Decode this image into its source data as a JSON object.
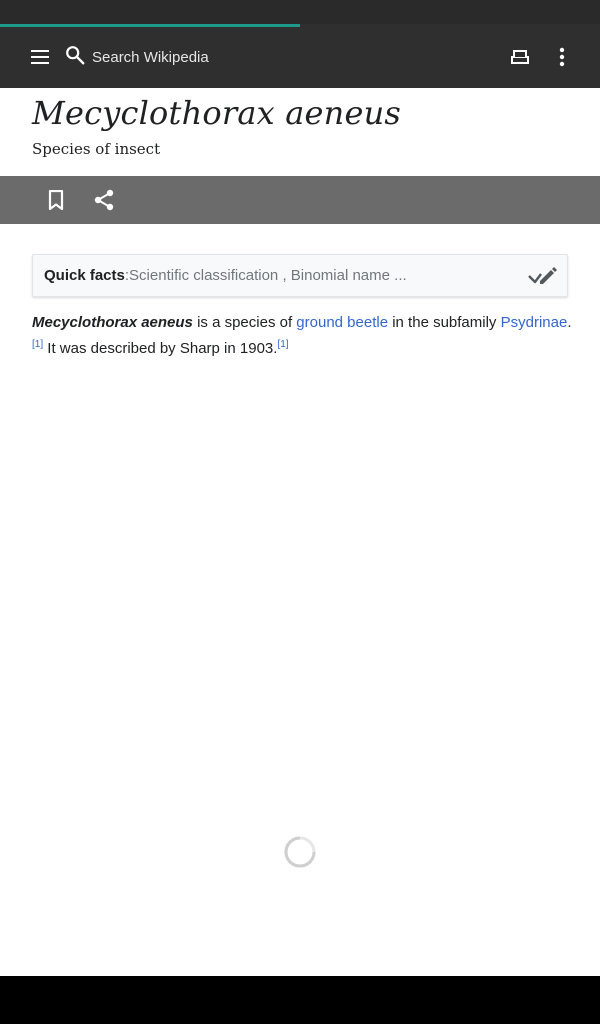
{
  "load_progress": 0.5,
  "colors": {
    "accent": "#1d9a8c",
    "toolbar": "#2f2f2f",
    "action_bar": "#6b6b6b",
    "link": "#3366cc"
  },
  "toolbar": {
    "menu_icon": "hamburger-menu-icon",
    "search_icon": "search-icon",
    "search_placeholder": "Search Wikipedia",
    "reading_icon": "reading-lists-icon",
    "overflow_icon": "more-vertical-icon"
  },
  "header": {
    "title": "Mecyclothorax aeneus",
    "description": "Species of insect"
  },
  "actions": {
    "bookmark_icon": "bookmark-icon",
    "share_icon": "share-icon"
  },
  "quick_facts": {
    "label": "Quick facts",
    "separator": ": ",
    "text": "Scientific classification , Binomial name ...",
    "icon": "edit-check-icon"
  },
  "article": {
    "subject": "Mecyclothorax aeneus",
    "t1": " is a species of ",
    "link1": "ground beetle",
    "t2": " in the subfamily ",
    "link2": "Psydrinae",
    "t3": ".",
    "ref1": "[1]",
    "t4": " It was described by Sharp in 1903.",
    "ref2": "[1]"
  }
}
